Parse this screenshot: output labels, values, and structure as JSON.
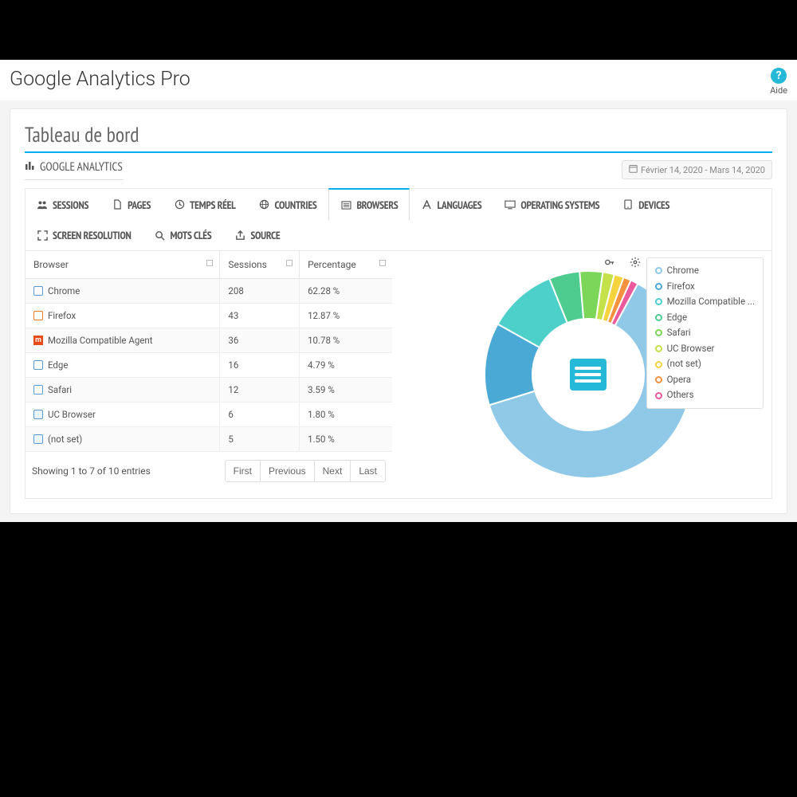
{
  "header": {
    "title": "Google Analytics Pro",
    "help": "Aide"
  },
  "panel": {
    "title": "Tableau de bord",
    "subtitle": "GOOGLE ANALYTICS",
    "date_range": "Février 14, 2020 - Mars 14, 2020"
  },
  "tabs": [
    {
      "icon": "group-icon",
      "label": "SESSIONS"
    },
    {
      "icon": "file-icon",
      "label": "PAGES"
    },
    {
      "icon": "clock-icon",
      "label": "TEMPS RÉEL"
    },
    {
      "icon": "globe-icon",
      "label": "COUNTRIES"
    },
    {
      "icon": "list-icon",
      "label": "BROWSERS",
      "active": true
    },
    {
      "icon": "font-icon",
      "label": "LANGUAGES"
    },
    {
      "icon": "monitor-icon",
      "label": "OPERATING SYSTEMS"
    },
    {
      "icon": "tablet-icon",
      "label": "DEVICES"
    },
    {
      "icon": "expand-icon",
      "label": "SCREEN RESOLUTION"
    },
    {
      "icon": "search-icon",
      "label": "MOTS CLÉS"
    },
    {
      "icon": "share-icon",
      "label": "SOURCE"
    }
  ],
  "table": {
    "columns": [
      "Browser",
      "Sessions",
      "Percentage"
    ],
    "rows": [
      {
        "icon": "chrome",
        "browser": "Chrome",
        "sessions": "208",
        "percentage": "62.28 %"
      },
      {
        "icon": "firefox",
        "browser": "Firefox",
        "sessions": "43",
        "percentage": "12.87 %"
      },
      {
        "icon": "mozilla",
        "browser": "Mozilla Compatible Agent",
        "sessions": "36",
        "percentage": "10.78 %"
      },
      {
        "icon": "edge",
        "browser": "Edge",
        "sessions": "16",
        "percentage": "4.79 %"
      },
      {
        "icon": "safari",
        "browser": "Safari",
        "sessions": "12",
        "percentage": "3.59 %"
      },
      {
        "icon": "uc",
        "browser": "UC Browser",
        "sessions": "6",
        "percentage": "1.80 %"
      },
      {
        "icon": "notset",
        "browser": "(not set)",
        "sessions": "5",
        "percentage": "1.50 %"
      }
    ],
    "summary": "Showing 1 to 7 of 10 entries",
    "pager": {
      "first": "First",
      "prev": "Previous",
      "next": "Next",
      "last": "Last"
    }
  },
  "legend": [
    {
      "label": "Chrome",
      "color": "#90c9e8"
    },
    {
      "label": "Firefox",
      "color": "#4aa9d5"
    },
    {
      "label": "Mozilla Compatible ...",
      "color": "#4dd0c9"
    },
    {
      "label": "Edge",
      "color": "#4ecb8f"
    },
    {
      "label": "Safari",
      "color": "#7bd65a"
    },
    {
      "label": "UC Browser",
      "color": "#c5e14a"
    },
    {
      "label": "(not set)",
      "color": "#f5d33f"
    },
    {
      "label": "Opera",
      "color": "#f5923e"
    },
    {
      "label": "Others",
      "color": "#e85a9b"
    }
  ],
  "chart_data": {
    "type": "pie",
    "title": "Browsers",
    "series": [
      {
        "name": "Chrome",
        "value": 62.28,
        "color": "#90c9e8"
      },
      {
        "name": "Firefox",
        "value": 12.87,
        "color": "#4aa9d5"
      },
      {
        "name": "Mozilla Compatible Agent",
        "value": 10.78,
        "color": "#4dd0c9"
      },
      {
        "name": "Edge",
        "value": 4.79,
        "color": "#4ecb8f"
      },
      {
        "name": "Safari",
        "value": 3.59,
        "color": "#7bd65a"
      },
      {
        "name": "UC Browser",
        "value": 1.8,
        "color": "#c5e14a"
      },
      {
        "name": "(not set)",
        "value": 1.5,
        "color": "#f5d33f"
      },
      {
        "name": "Opera",
        "value": 1.2,
        "color": "#f5923e"
      },
      {
        "name": "Others",
        "value": 1.19,
        "color": "#e85a9b"
      }
    ]
  }
}
